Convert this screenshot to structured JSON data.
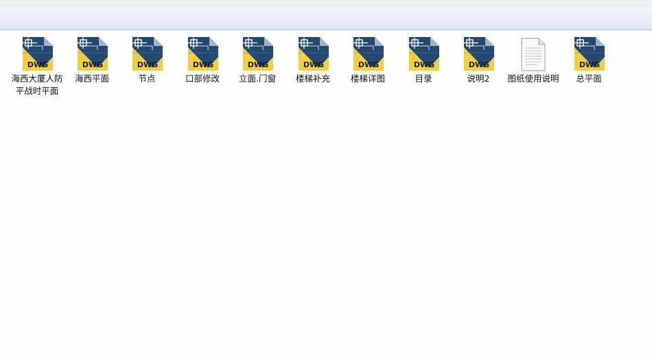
{
  "window": {
    "files": [
      {
        "name": "海西大厦人防平战时平面",
        "type": "dwg",
        "badge": "DWG"
      },
      {
        "name": "海西平面",
        "type": "dwg",
        "badge": "DWG"
      },
      {
        "name": "节点",
        "type": "dwg",
        "badge": "DWG"
      },
      {
        "name": "口部修改",
        "type": "dwg",
        "badge": "DWG"
      },
      {
        "name": "立面.门窗",
        "type": "dwg",
        "badge": "DWG"
      },
      {
        "name": "楼梯补充",
        "type": "dwg",
        "badge": "DWG"
      },
      {
        "name": "楼梯详图",
        "type": "dwg",
        "badge": "DWG"
      },
      {
        "name": "目录",
        "type": "dwg",
        "badge": "DWG"
      },
      {
        "name": "说明2",
        "type": "dwg",
        "badge": "DWG"
      },
      {
        "name": "图纸使用说明",
        "type": "txt",
        "badge": ""
      },
      {
        "name": "总平面",
        "type": "dwg",
        "badge": "DWG"
      }
    ],
    "colors": {
      "dwg_dark": "#244a72",
      "dwg_yellow": "#f3cf3e",
      "toolbar_bg": "#e8eef8"
    },
    "icons": {
      "dwg": "dwg-file-icon",
      "txt": "text-document-icon"
    }
  }
}
